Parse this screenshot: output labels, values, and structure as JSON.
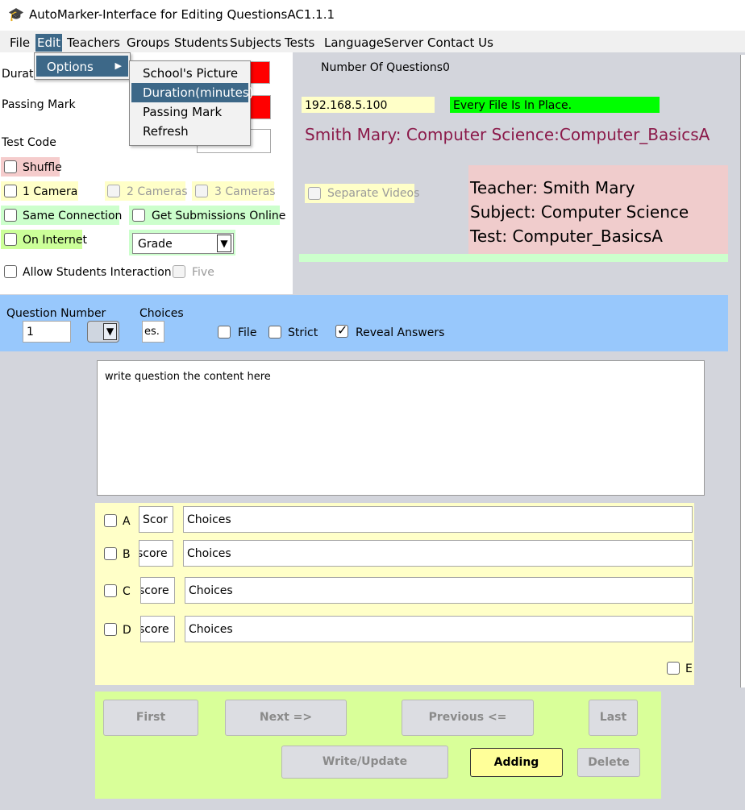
{
  "window": {
    "title": "AutoMarker-Interface for Editing QuestionsAC1.1.1"
  },
  "menubar": {
    "items": [
      "File",
      "Edit",
      "Teachers",
      "Groups",
      "Students",
      "Subjects",
      "Tests",
      "Language",
      "Server",
      "Contact Us"
    ]
  },
  "edit_menu": {
    "options_label": "Options",
    "arrow": "▶"
  },
  "options_submenu": {
    "items": [
      "School's Picture",
      "Duration(minutes)",
      "Passing Mark",
      "Refresh"
    ]
  },
  "left_panel": {
    "duration_label": "Durati",
    "passing_mark_label": "Passing Mark",
    "test_code_label": "Test Code",
    "shuffle_label": "Shuffle",
    "one_camera_label": "1 Camera",
    "two_cameras_label": "2 Cameras",
    "three_cameras_label": "3 Cameras",
    "same_connection_label": "Same Connection",
    "get_submissions_label": "Get Submissions Online",
    "on_internet_label": "On Internet",
    "grade_select": "Grade",
    "allow_interaction_label": "Allow Students Interaction",
    "five_label": "Five"
  },
  "right_panel": {
    "num_questions": "Number Of Questions0",
    "ip_address": "192.168.5.100",
    "file_status": "Every File Is In Place.",
    "headline": "Smith Mary: Computer Science:Computer_BasicsA",
    "separate_videos_label": "Separate Videos",
    "teacher": "Teacher: Smith Mary",
    "subject": "Subject: Computer Science",
    "test": "Test: Computer_BasicsA"
  },
  "question_bar": {
    "question_number_label": "Question Number",
    "question_number_value": "1",
    "choices_label": "Choices",
    "choices_value": "es.",
    "file_label": "File",
    "strict_label": "Strict",
    "reveal_answers_label": "Reveal Answers"
  },
  "question_text": "write question the content here",
  "choices": [
    {
      "letter": "A",
      "score": "Scor",
      "text": "Choices"
    },
    {
      "letter": "B",
      "score": "score",
      "text": "Choices"
    },
    {
      "letter": "C",
      "score": "score",
      "text": "Choices"
    },
    {
      "letter": "D",
      "score": "score",
      "text": "Choices"
    }
  ],
  "extra_choice_label": "E",
  "buttons": {
    "first": "First",
    "next": "Next =>",
    "previous": "Previous <=",
    "last": "Last",
    "write_update": "Write/Update",
    "adding": "Adding",
    "delete": "Delete"
  },
  "colors": {
    "menu_highlight": "#3d6888",
    "red_field": "#ff0000",
    "green_status": "#00ff00",
    "blue_bar": "#98c8fc",
    "choices_bg": "#ffffc8",
    "buttons_bg": "#d9ff99",
    "headline": "#8b1a4a"
  }
}
